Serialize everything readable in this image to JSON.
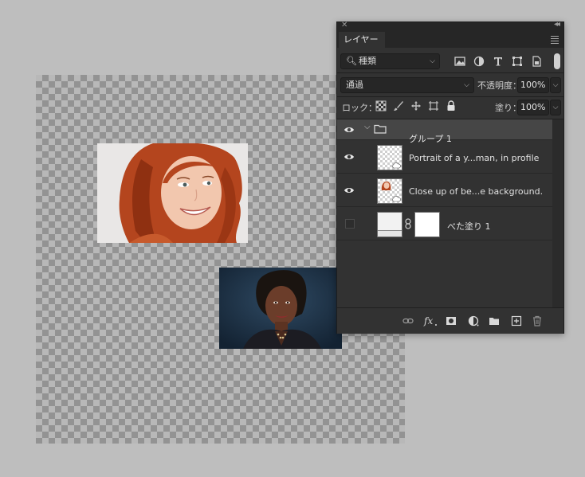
{
  "canvas": {
    "photo1_alt": "",
    "photo2_alt": ""
  },
  "panel": {
    "tab_label": "レイヤー",
    "kind_filter": "種類",
    "blend_mode": "通過",
    "opacity_label": "不透明度：",
    "opacity_value": "100%",
    "lock_label": "ロック：",
    "fill_label": "塗り：",
    "fill_value": "100%",
    "layers": [
      {
        "name": "グループ 1",
        "type": "group",
        "visible": true
      },
      {
        "name": "Portrait of a y...man, in profile",
        "type": "smart-object",
        "visible": true
      },
      {
        "name": "Close up of be...e background.",
        "type": "smart-object",
        "visible": true
      },
      {
        "name": "べた塗り 1",
        "type": "fill",
        "visible": false
      }
    ]
  },
  "colors": {
    "panel_bg": "#323232",
    "selected_row": "#464646",
    "canvas_bg": "#bebebe"
  }
}
